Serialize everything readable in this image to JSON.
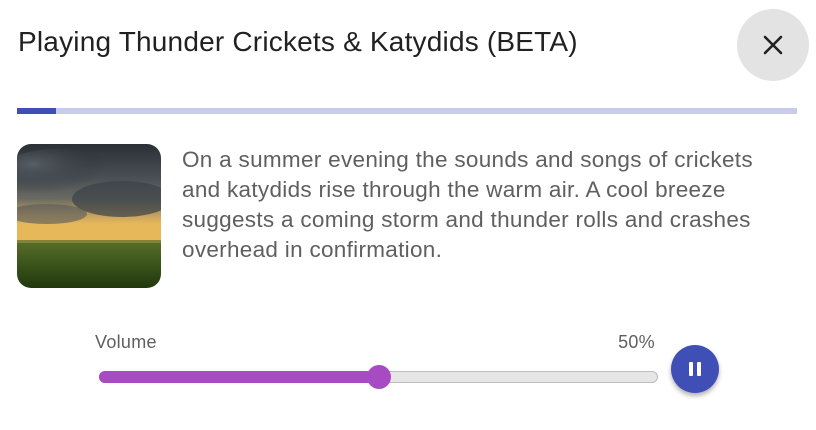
{
  "dialog": {
    "title": "Playing Thunder Crickets & Katydids (BETA)",
    "close_icon": "close-icon"
  },
  "playback": {
    "progress_percent": 5
  },
  "track": {
    "description": "On a summer evening the sounds and songs of crickets and katydids rise through the warm air. A cool breeze suggests a coming storm and thunder rolls and crashes overhead in confirmation.",
    "image": "stormy-field-thumbnail"
  },
  "volume": {
    "label": "Volume",
    "value_text": "50%",
    "value_percent": 50
  },
  "controls": {
    "pause_icon": "pause-icon"
  },
  "colors": {
    "accent_primary": "#3f4fb5",
    "accent_secondary": "#a74bc2",
    "progress_track": "#c9cbea"
  }
}
